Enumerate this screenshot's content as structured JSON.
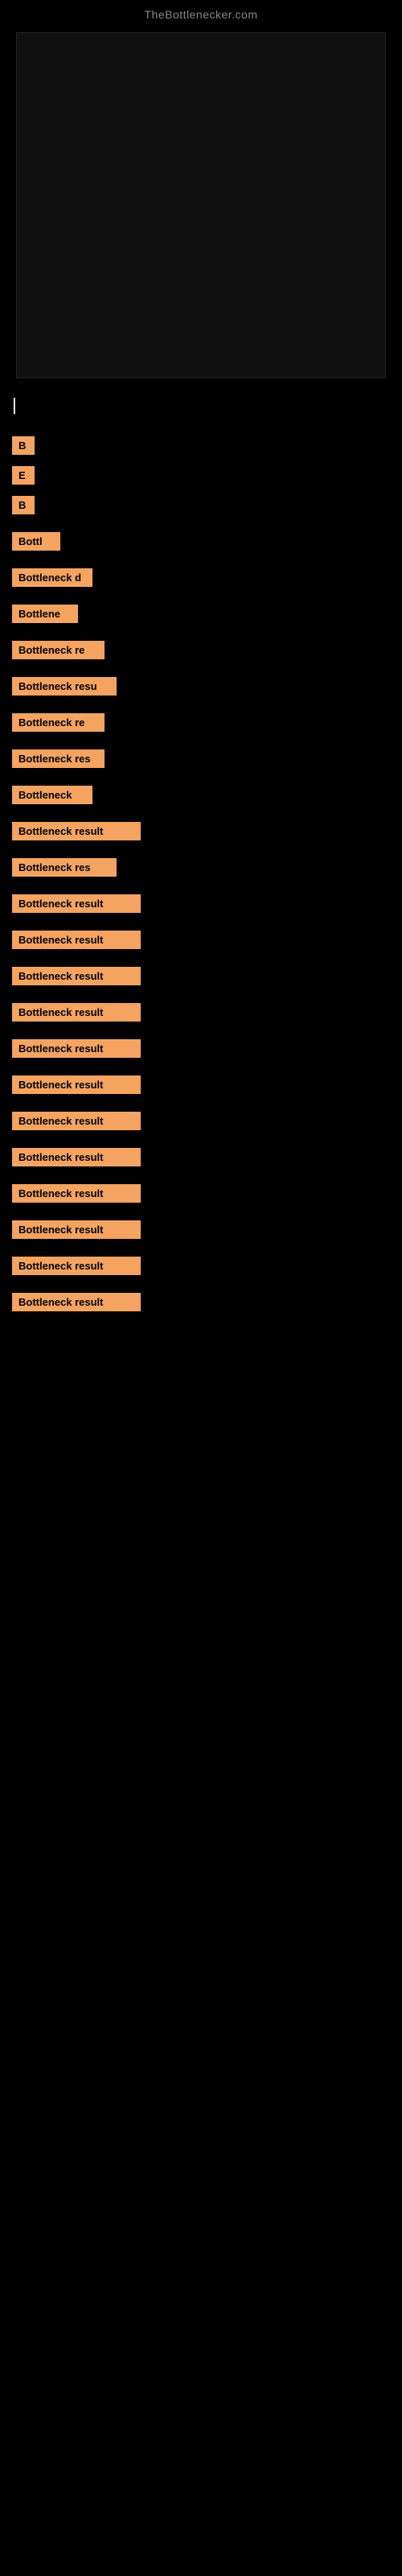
{
  "site": {
    "title": "TheBottlenecker.com"
  },
  "results": [
    {
      "id": 1,
      "label": "B",
      "widthClass": "w-xs"
    },
    {
      "id": 2,
      "label": "E",
      "widthClass": "w-xs"
    },
    {
      "id": 3,
      "label": "B",
      "widthClass": "w-xs"
    },
    {
      "id": 4,
      "label": "Bottl",
      "widthClass": "w-md"
    },
    {
      "id": 5,
      "label": "Bottleneck d",
      "widthClass": "w-xl"
    },
    {
      "id": 6,
      "label": "Bottlene",
      "widthClass": "w-lg"
    },
    {
      "id": 7,
      "label": "Bottleneck re",
      "widthClass": "w-2xl"
    },
    {
      "id": 8,
      "label": "Bottleneck resu",
      "widthClass": "w-3xl"
    },
    {
      "id": 9,
      "label": "Bottleneck re",
      "widthClass": "w-2xl"
    },
    {
      "id": 10,
      "label": "Bottleneck res",
      "widthClass": "w-2xl"
    },
    {
      "id": 11,
      "label": "Bottleneck",
      "widthClass": "w-xl"
    },
    {
      "id": 12,
      "label": "Bottleneck result",
      "widthClass": "w-full"
    },
    {
      "id": 13,
      "label": "Bottleneck res",
      "widthClass": "w-3xl"
    },
    {
      "id": 14,
      "label": "Bottleneck result",
      "widthClass": "w-full"
    },
    {
      "id": 15,
      "label": "Bottleneck result",
      "widthClass": "w-full"
    },
    {
      "id": 16,
      "label": "Bottleneck result",
      "widthClass": "w-full"
    },
    {
      "id": 17,
      "label": "Bottleneck result",
      "widthClass": "w-full"
    },
    {
      "id": 18,
      "label": "Bottleneck result",
      "widthClass": "w-full"
    },
    {
      "id": 19,
      "label": "Bottleneck result",
      "widthClass": "w-full"
    },
    {
      "id": 20,
      "label": "Bottleneck result",
      "widthClass": "w-full"
    },
    {
      "id": 21,
      "label": "Bottleneck result",
      "widthClass": "w-full"
    },
    {
      "id": 22,
      "label": "Bottleneck result",
      "widthClass": "w-full"
    },
    {
      "id": 23,
      "label": "Bottleneck result",
      "widthClass": "w-full"
    },
    {
      "id": 24,
      "label": "Bottleneck result",
      "widthClass": "w-full"
    },
    {
      "id": 25,
      "label": "Bottleneck result",
      "widthClass": "w-full"
    }
  ]
}
